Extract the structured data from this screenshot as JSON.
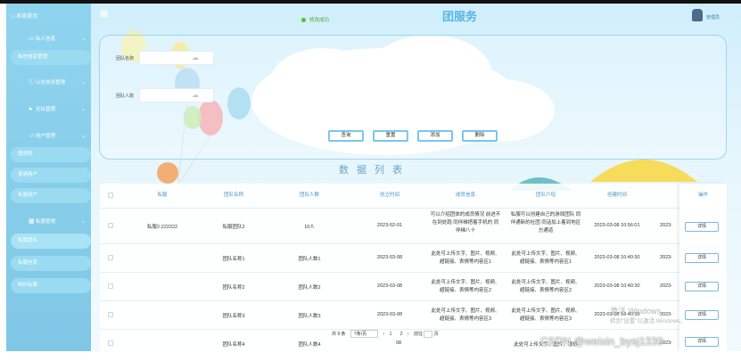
{
  "sidebar": {
    "brand": "系统首页",
    "groups": [
      {
        "label": "私人信息",
        "icon": "menu-icon"
      },
      {
        "label": "私信信息管理",
        "sub": true
      },
      {
        "label": "公告信息管理",
        "icon": "info-icon"
      },
      {
        "label": "论坛管理",
        "icon": "location-icon"
      },
      {
        "label": "用户管理",
        "icon": "user-icon"
      },
      {
        "label": "管理员",
        "sub": true
      },
      {
        "label": "普通用户",
        "sub": true
      },
      {
        "label": "私服用户",
        "sub": true
      },
      {
        "label": "私服管理",
        "icon": "grid-icon"
      },
      {
        "label": "私服团队",
        "sub": true
      },
      {
        "label": "私服信息",
        "sub": true
      },
      {
        "label": "特价私服",
        "sub": true
      }
    ]
  },
  "header": {
    "toast": "修改成功",
    "title": "团服务",
    "user_label": "管理员"
  },
  "search": {
    "field1_label": "团队名称",
    "field2_label": "团队人数",
    "buttons": [
      "查询",
      "重置",
      "添加",
      "删除"
    ]
  },
  "list_title": "数据列表",
  "table": {
    "headers": [
      "私服",
      "团队名称",
      "团队人数",
      "创立时间",
      "成员信息",
      "团队介绍",
      "创建时间",
      "",
      "操作"
    ],
    "rows": [
      {
        "c1": "私服2-222222",
        "c2": "私服团队2",
        "c3": "10人",
        "c4": "2023-02-01",
        "c5": "可以介绍团体的成员情况 前进不在到处跑 同伴梯把着手机的 同伴梯八十",
        "c6": "私服可以创建自己的游戏团队 同伴通新的社团 同话加上着到地区方通道",
        "c7": "2023-03-08 10:56:01",
        "c8": "2023-",
        "op": "详情"
      },
      {
        "c1": "",
        "c2": "团队名称1",
        "c3": "团队人数1",
        "c4": "2023-03-08",
        "c5": "此处可上传文字、图片、视频、超链接、表情等内容区1",
        "c6": "此处可上传文字、图片、视频、超链接、表情等内容区1",
        "c7": "2023-03-08 10:40:30",
        "c8": "2023-",
        "op": "详情"
      },
      {
        "c1": "",
        "c2": "团队名称2",
        "c3": "团队人数2",
        "c4": "2023-03-08",
        "c5": "此处可上传文字、图片、视频、超链接、表情等内容区2",
        "c6": "此处可上传文字、图片、视频、超链接、表情等内容区2",
        "c7": "2023-03-08 10:40:30",
        "c8": "2023-",
        "op": "详情"
      },
      {
        "c1": "",
        "c2": "团队名称3",
        "c3": "团队人数3",
        "c4": "2023-03-08",
        "c5": "此处可上传文字、图片、视频、超链接、表情等内容区3",
        "c6": "此处可上传文字、图片、视频、超链接、表情等内容区3",
        "c7": "2023-03-08 10:40:30",
        "c8": "2023-",
        "op": "详情"
      },
      {
        "c1": "",
        "c2": "团队名称4",
        "c3": "团队人数4",
        "c4": "08",
        "c5": "",
        "c6": "此处可上传文字、图片、视频",
        "c7": "",
        "c8": "2023-",
        "op": "详情"
      }
    ]
  },
  "pager": {
    "total": "共 9 条",
    "size": "7条/页",
    "pages": [
      "1",
      "2"
    ],
    "goto": "前往",
    "page_suffix": "页"
  },
  "watermark": {
    "line1": "激活 Windows",
    "line2": "转到\"设置\"以激活 Windows。"
  },
  "csdn": "CSDN @weixin_bysj1330",
  "colors": {
    "sidebar": "#86cde9",
    "accent": "#56b6e6",
    "button_border": "#79c7ea"
  }
}
